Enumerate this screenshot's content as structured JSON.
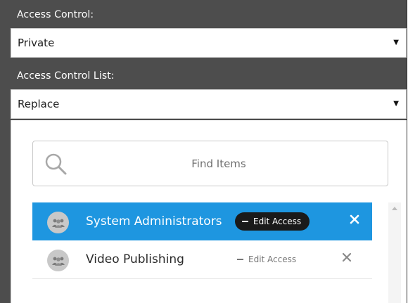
{
  "access_control": {
    "label": "Access Control:",
    "value": "Private",
    "caret": "▼"
  },
  "acl": {
    "label": "Access Control List:",
    "value": "Replace",
    "caret": "▼"
  },
  "search": {
    "placeholder": "Find Items",
    "icon": "search-icon"
  },
  "items": [
    {
      "label": "System Administrators",
      "edit_label": "Edit Access",
      "icon": "group-icon",
      "remove_icon": "close-icon",
      "selected": true
    },
    {
      "label": "Video Publishing",
      "edit_label": "Edit Access",
      "icon": "group-icon",
      "remove_icon": "close-icon",
      "selected": false
    }
  ],
  "colors": {
    "panel_bg": "#4d4d4d",
    "selected_bg": "#1e96e0",
    "pill_bg": "#1a1a1a"
  }
}
